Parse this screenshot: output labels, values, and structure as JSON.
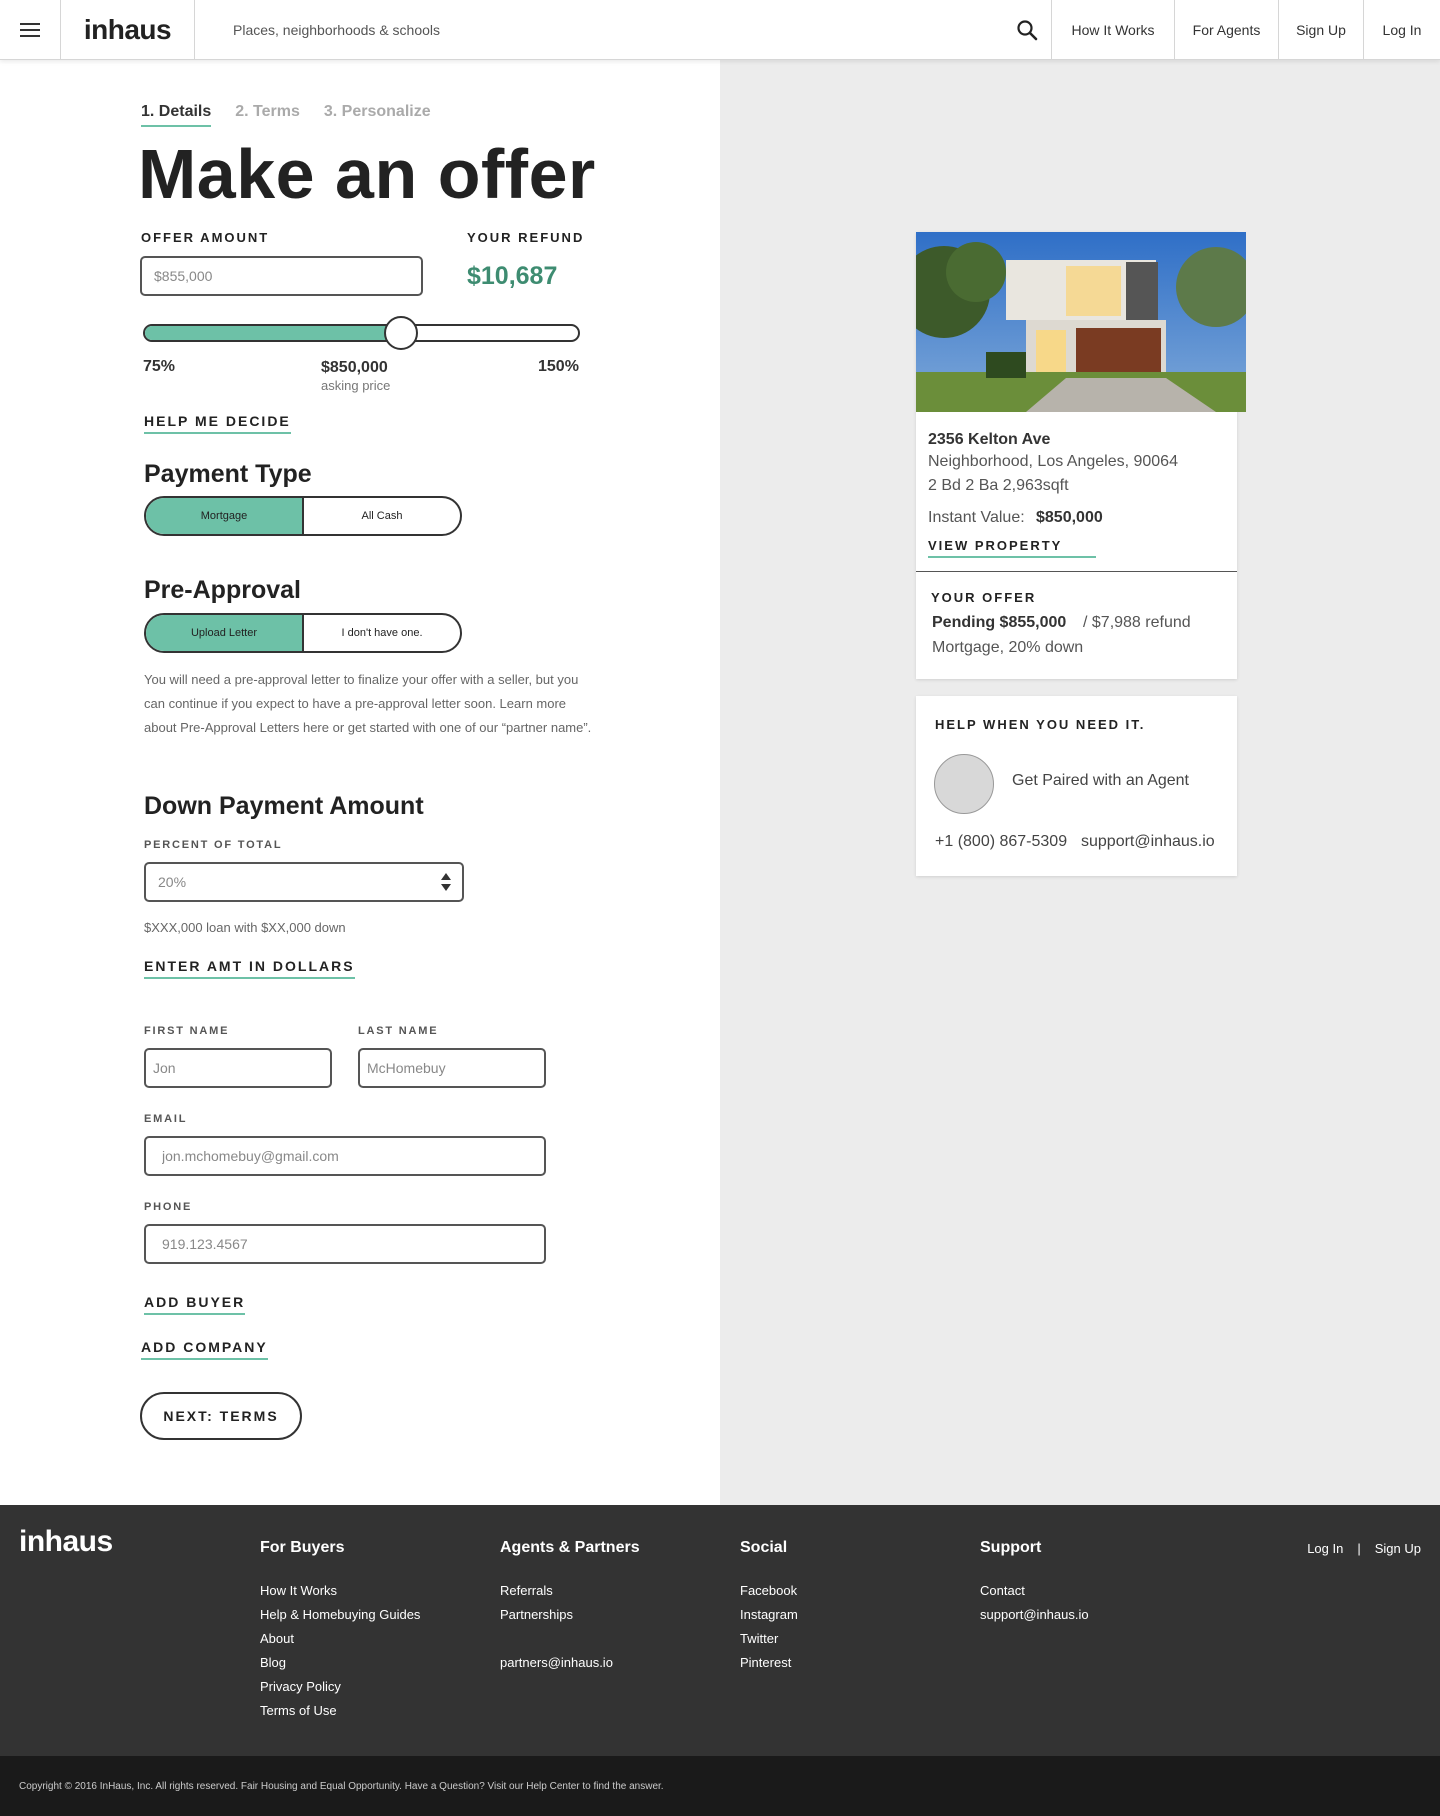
{
  "header": {
    "logo": "inhaus",
    "search_placeholder": "Places, neighborhoods & schools",
    "nav": [
      "How It Works",
      "For Agents",
      "Sign Up",
      "Log In"
    ]
  },
  "steps": [
    "1. Details",
    "2. Terms",
    "3. Personalize"
  ],
  "title": "Make an offer",
  "offer": {
    "amount_label": "OFFER AMOUNT",
    "amount_placeholder": "$855,000",
    "refund_label": "YOUR REFUND",
    "refund_value": "$10,687",
    "slider_fraction": 0.59,
    "range_min": "75%",
    "asking_value": "$850,000",
    "asking_label": "asking price",
    "range_max": "150%",
    "help_link": "HELP ME DECIDE"
  },
  "payment_type": {
    "heading": "Payment Type",
    "options": [
      "Mortgage",
      "All Cash"
    ],
    "selected": "Mortgage"
  },
  "pre_approval": {
    "heading": "Pre-Approval",
    "options": [
      "Upload Letter",
      "I don't have one."
    ],
    "selected": "Upload Letter",
    "text": "You will need a pre-approval letter to finalize your offer with a seller, but you can continue if you expect to have a pre-approval letter soon. Learn more about Pre-Approval Letters here or get started with one of our “partner name”."
  },
  "down_payment": {
    "heading": "Down Payment Amount",
    "percent_label": "PERCENT OF TOTAL",
    "percent_value": "20%",
    "helper": "$XXX,000 loan with $XX,000 down",
    "dollars_link": "ENTER AMT IN DOLLARS"
  },
  "buyer": {
    "first_name_label": "FIRST NAME",
    "first_name_placeholder": "Jon",
    "last_name_label": "LAST NAME",
    "last_name_placeholder": "McHomebuy",
    "email_label": "EMAIL",
    "email_placeholder": "jon.mchomebuy@gmail.com",
    "phone_label": "PHONE",
    "phone_placeholder": "919.123.4567",
    "add_buyer": "ADD BUYER",
    "add_company": "ADD COMPANY",
    "next": "NEXT: TERMS"
  },
  "property": {
    "address": "2356 Kelton Ave",
    "location": "Neighborhood, Los Angeles, 90064",
    "specs": "2 Bd 2 Ba 2,963sqft",
    "instant_value_label": "Instant Value:",
    "instant_value": "$850,000",
    "view_link": "VIEW PROPERTY",
    "your_offer_label": "YOUR OFFER",
    "pending": "Pending $855,000",
    "refund": "/ $7,988 refund",
    "detail": "Mortgage, 20% down"
  },
  "help": {
    "heading": "HELP WHEN YOU NEED IT.",
    "agent": "Get Paired with an Agent",
    "phone": "+1 (800) 867-5309",
    "email": "support@inhaus.io"
  },
  "footer": {
    "logo": "inhaus",
    "columns": [
      {
        "title": "For Buyers",
        "links": [
          "How It Works",
          "Help & Homebuying Guides",
          "About",
          "Blog",
          "Privacy Policy",
          "Terms of Use"
        ]
      },
      {
        "title": "Agents & Partners",
        "links": [
          "Referrals",
          "Partnerships",
          "partners@inhaus.io"
        ]
      },
      {
        "title": "Social",
        "links": [
          "Facebook",
          "Instagram",
          "Twitter",
          "Pinterest"
        ]
      },
      {
        "title": "Support",
        "links": [
          "Contact",
          "support@inhaus.io"
        ]
      }
    ],
    "login": "Log In",
    "separator": "|",
    "signup": "Sign Up",
    "copyright": "Copyright © 2016 InHaus, Inc. All rights reserved. Fair Housing and Equal Opportunity. Have a Question? Visit our Help Center to find the answer."
  },
  "colors": {
    "accent": "#6dc1a7",
    "refund": "#3e8c71",
    "footer": "#333333",
    "footer_bottom": "#1a1a1a",
    "panel": "#ececec"
  }
}
